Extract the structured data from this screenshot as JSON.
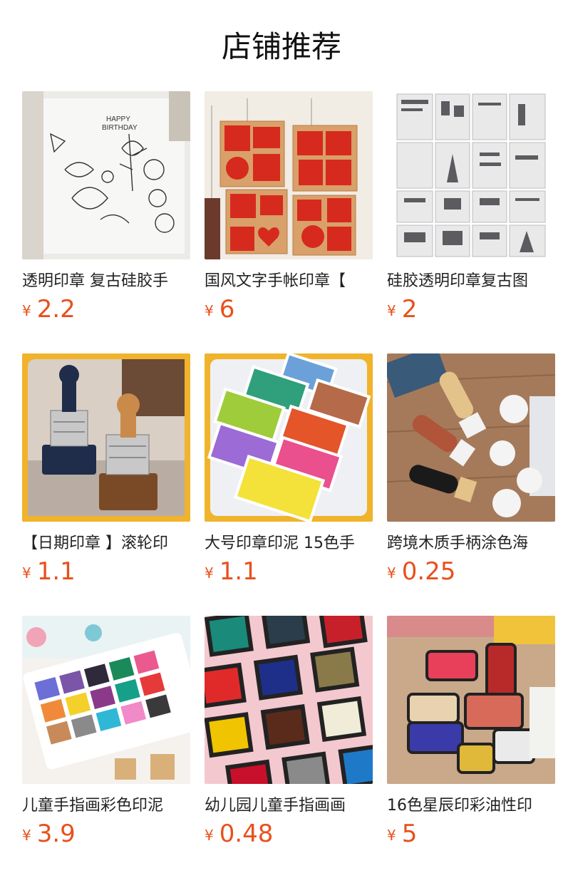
{
  "header": {
    "title": "店铺推荐"
  },
  "currency_symbol": "¥",
  "products": [
    {
      "name": "透明印章 复古硅胶手",
      "price": "2.2",
      "image": "clear-floral-stamp-sheet-image"
    },
    {
      "name": "国风文字手帐印章【",
      "price": "6",
      "image": "chinese-characters-wooden-stamps-image"
    },
    {
      "name": "硅胶透明印章复古图",
      "price": "2",
      "image": "vintage-clear-stamp-sheets-image"
    },
    {
      "name": "【日期印章 】滚轮印",
      "price": "1.1",
      "image": "date-roller-stamps-image"
    },
    {
      "name": "大号印章印泥 15色手",
      "price": "1.1",
      "image": "craft-ink-pads-image"
    },
    {
      "name": "跨境木质手柄涂色海",
      "price": "0.25",
      "image": "wooden-handle-sponge-daubers-image"
    },
    {
      "name": "儿童手指画彩色印泥",
      "price": "3.9",
      "image": "kids-finger-paint-ink-set-image"
    },
    {
      "name": "幼儿园儿童手指画画",
      "price": "0.48",
      "image": "colorful-ink-pads-grid-image"
    },
    {
      "name": "16色星辰印彩油性印",
      "price": "5",
      "image": "oil-based-ink-pads-tins-image"
    }
  ]
}
